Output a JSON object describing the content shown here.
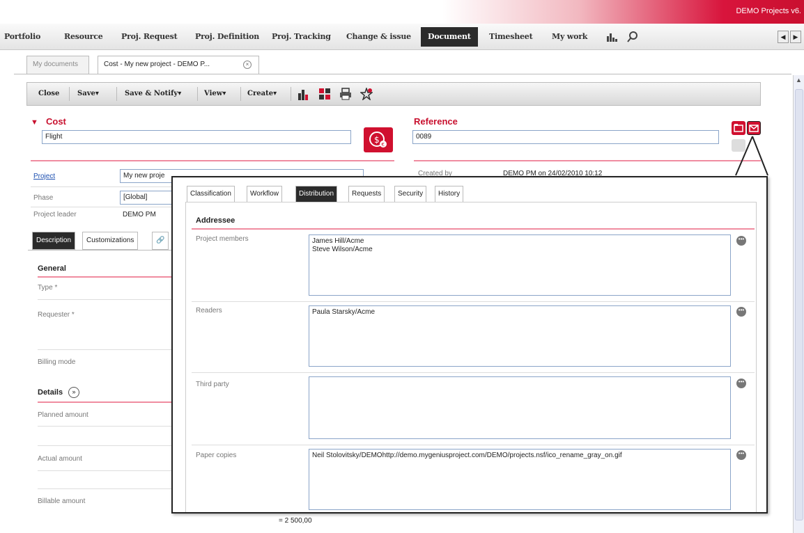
{
  "app": {
    "brand": "DEMO Projects v6."
  },
  "menu": {
    "items": [
      "Portfolio",
      "Resource",
      "Proj. Request",
      "Proj. Definition",
      "Proj. Tracking",
      "Change & issue",
      "Document",
      "Timesheet",
      "My work"
    ],
    "active": "Document"
  },
  "doc_tabs": [
    {
      "label": "My documents"
    },
    {
      "label": "Cost - My new project - DEMO P..."
    }
  ],
  "toolbar": {
    "close": "Close",
    "save": "Save",
    "save_notify": "Save & Notify",
    "view": "View",
    "create": "Create"
  },
  "cost": {
    "title": "Cost",
    "value": "Flight"
  },
  "reference": {
    "title": "Reference",
    "value": "0089"
  },
  "project": {
    "label": "Project",
    "value": "My new proje",
    "created_by_label": "Created by",
    "created_by_value": "DEMO PM on 24/02/2010 10:12"
  },
  "phase": {
    "label": "Phase",
    "value": "[Global]"
  },
  "leader": {
    "label": "Project leader",
    "value": "DEMO PM"
  },
  "sub_tabs": [
    "Description",
    "Customizations"
  ],
  "general": {
    "title": "General",
    "type_label": "Type *",
    "requester_label": "Requester *",
    "billing_label": "Billing mode"
  },
  "details": {
    "title": "Details",
    "planned_label": "Planned amount",
    "actual_label": "Actual amount",
    "billable_label": "Billable amount",
    "bottom_value": "= 2 500,00"
  },
  "popup": {
    "tabs": [
      "Classification",
      "Workflow",
      "Distribution",
      "Requests",
      "Security",
      "History"
    ],
    "active_tab": "Distribution",
    "section_title": "Addressee",
    "rows": [
      {
        "label": "Project members",
        "lines": [
          "James Hill/Acme",
          "Steve Wilson/Acme"
        ]
      },
      {
        "label": "Readers",
        "lines": [
          "Paula Starsky/Acme"
        ]
      },
      {
        "label": "Third party",
        "lines": []
      },
      {
        "label": "Paper copies",
        "lines": [
          "Neil Stolovitsky/DEMOhttp://demo.mygeniusproject.com/DEMO/projects.nsf/ico_rename_gray_on.gif"
        ]
      }
    ]
  },
  "colors": {
    "accent": "#c8102e",
    "pink_line": "#f08ca0"
  }
}
